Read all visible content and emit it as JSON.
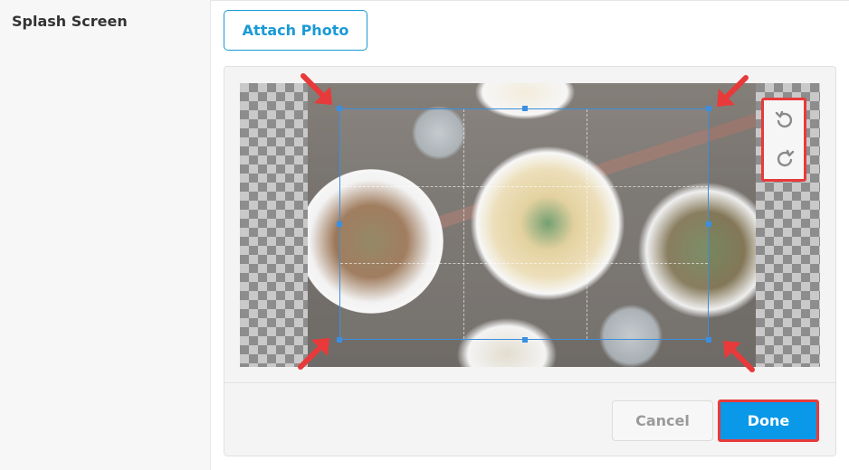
{
  "settings": {
    "section_label": "Splash Screen",
    "attach_button_label": "Attach Photo"
  },
  "cropper": {
    "image_description_icon": "food-photo",
    "tools": [
      {
        "icon": "rotate-left-icon"
      },
      {
        "icon": "rotate-right-icon"
      }
    ],
    "accent_color": "#3c8fe0",
    "highlight_color": "#e83a3a"
  },
  "actions": {
    "cancel_label": "Cancel",
    "done_label": "Done",
    "done_color": "#0a98e8"
  }
}
